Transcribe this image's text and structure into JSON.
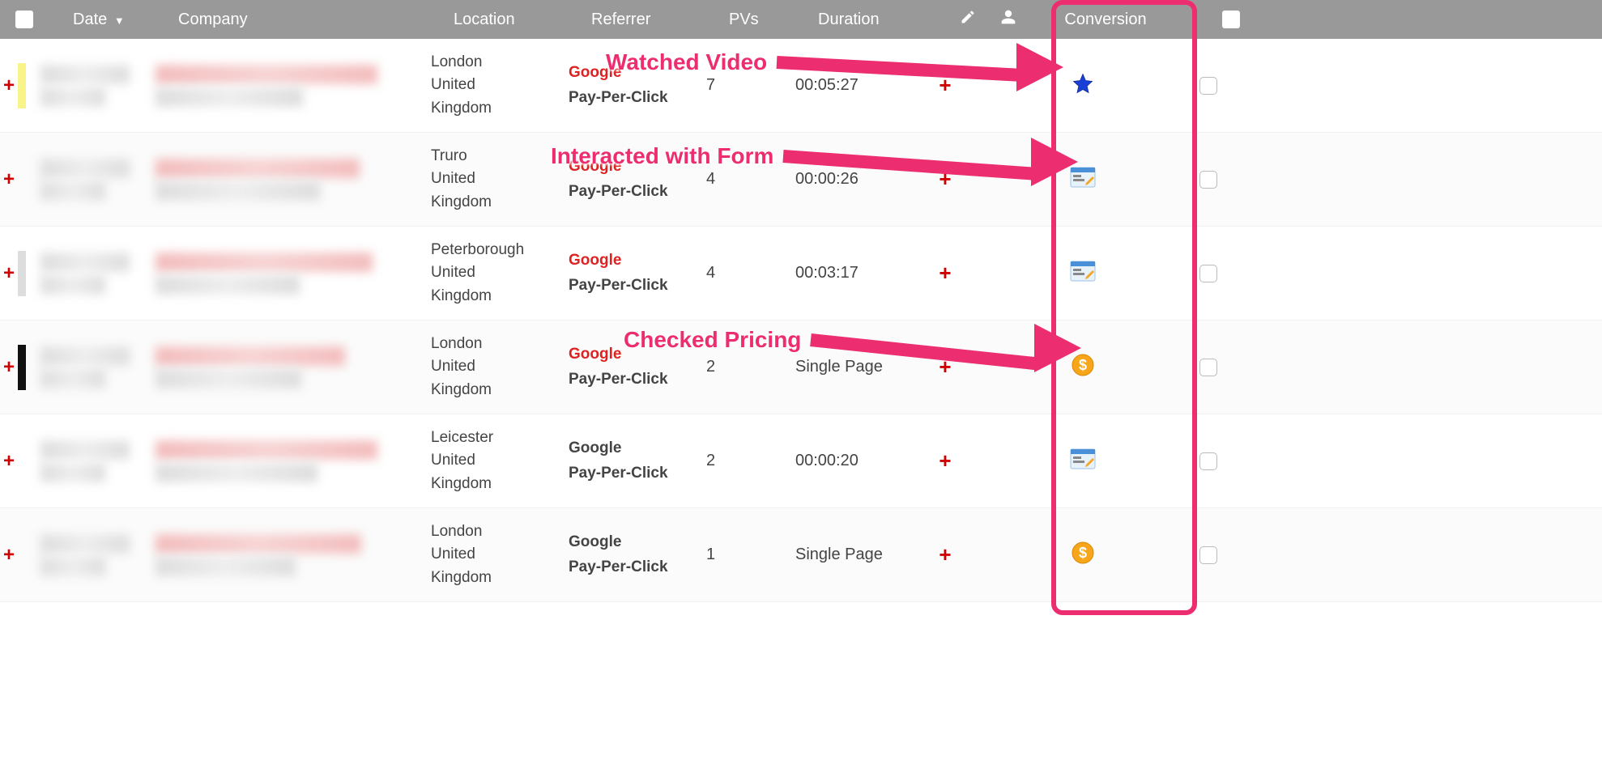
{
  "headers": {
    "date": "Date",
    "sort_indicator": "▼",
    "company": "Company",
    "location": "Location",
    "referrer": "Referrer",
    "pvs": "PVs",
    "duration": "Duration",
    "conversion": "Conversion"
  },
  "annotations": {
    "watched_video": "Watched Video",
    "interacted_form": "Interacted with Form",
    "checked_pricing": "Checked Pricing"
  },
  "rows": [
    {
      "bar_color": "bar-yellow",
      "location_city": "London",
      "location_country": "United Kingdom",
      "referrer_source": "Google",
      "referrer_hot": true,
      "referrer_type": "Pay-Per-Click",
      "pvs": "7",
      "duration": "00:05:27",
      "conversion": "star"
    },
    {
      "bar_color": "",
      "location_city": "Truro",
      "location_country": "United Kingdom",
      "referrer_source": "Google",
      "referrer_hot": true,
      "referrer_type": "Pay-Per-Click",
      "pvs": "4",
      "duration": "00:00:26",
      "conversion": "form"
    },
    {
      "bar_color": "bar-gray",
      "location_city": "Peterborough",
      "location_country": "United Kingdom",
      "referrer_source": "Google",
      "referrer_hot": true,
      "referrer_type": "Pay-Per-Click",
      "pvs": "4",
      "duration": "00:03:17",
      "conversion": "form"
    },
    {
      "bar_color": "bar-black",
      "location_city": "London",
      "location_country": "United Kingdom",
      "referrer_source": "Google",
      "referrer_hot": true,
      "referrer_type": "Pay-Per-Click",
      "pvs": "2",
      "duration": "Single Page",
      "conversion": "dollar"
    },
    {
      "bar_color": "",
      "location_city": "Leicester",
      "location_country": "United Kingdom",
      "referrer_source": "Google",
      "referrer_hot": false,
      "referrer_type": "Pay-Per-Click",
      "pvs": "2",
      "duration": "00:00:20",
      "conversion": "form"
    },
    {
      "bar_color": "",
      "location_city": "London",
      "location_country": "United Kingdom",
      "referrer_source": "Google",
      "referrer_hot": false,
      "referrer_type": "Pay-Per-Click",
      "pvs": "1",
      "duration": "Single Page",
      "conversion": "dollar"
    }
  ]
}
